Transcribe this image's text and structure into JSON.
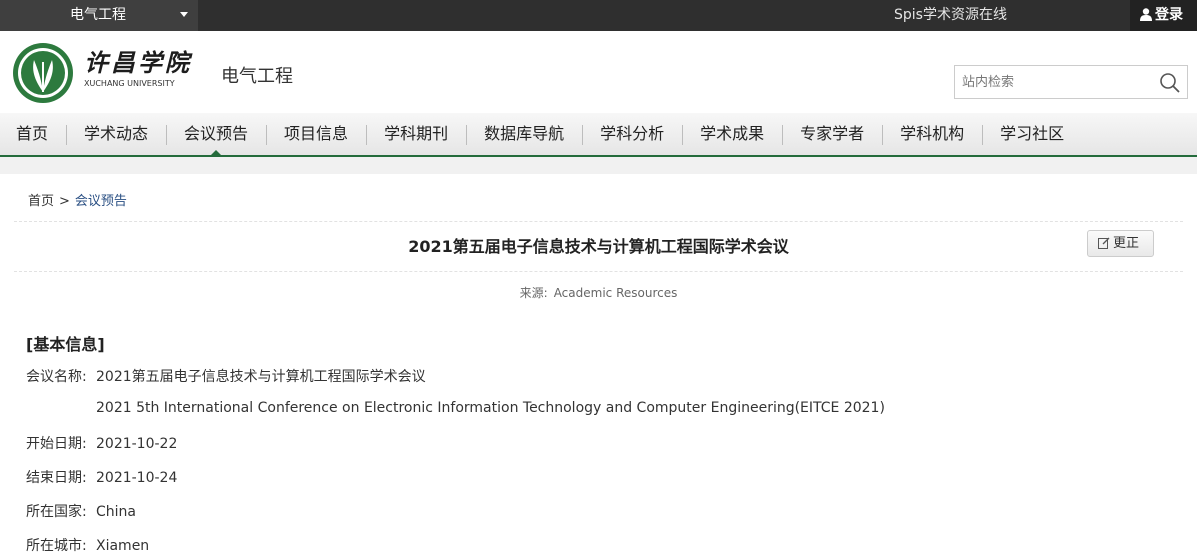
{
  "topbar": {
    "site_selector": "电气工程",
    "slogan": "Spis学术资源在线",
    "login_label": "登录"
  },
  "header": {
    "logo_cn": "许昌学院",
    "logo_en": "XUCHANG UNIVERSITY",
    "site_name": "电气工程",
    "search_placeholder": "站内检索"
  },
  "nav": {
    "items": [
      "首页",
      "学术动态",
      "会议预告",
      "项目信息",
      "学科期刊",
      "数据库导航",
      "学科分析",
      "学术成果",
      "专家学者",
      "学科机构",
      "学习社区"
    ],
    "active_index": 2
  },
  "breadcrumb": {
    "home": "首页",
    "separator": ">",
    "current": "会议预告"
  },
  "article": {
    "title": "2021第五届电子信息技术与计算机工程国际学术会议",
    "correct_label": "更正",
    "source_label": "来源:",
    "source_value": "Academic Resources",
    "section_title": "[基本信息]",
    "fields": [
      {
        "key": "会议名称:",
        "value": "2021第五届电子信息技术与计算机工程国际学术会议"
      },
      {
        "key": "",
        "value": "2021 5th International Conference on Electronic Information Technology and Computer Engineering(EITCE 2021)"
      },
      {
        "key": "开始日期:",
        "value": "2021-10-22"
      },
      {
        "key": "结束日期:",
        "value": "2021-10-24"
      },
      {
        "key": "所在国家:",
        "value": "China"
      },
      {
        "key": "所在城市:",
        "value": "Xiamen"
      }
    ]
  },
  "colors": {
    "accent_green": "#246b3b",
    "link_blue": "#2a4f83",
    "topbar_bg": "#2f2f2f"
  }
}
